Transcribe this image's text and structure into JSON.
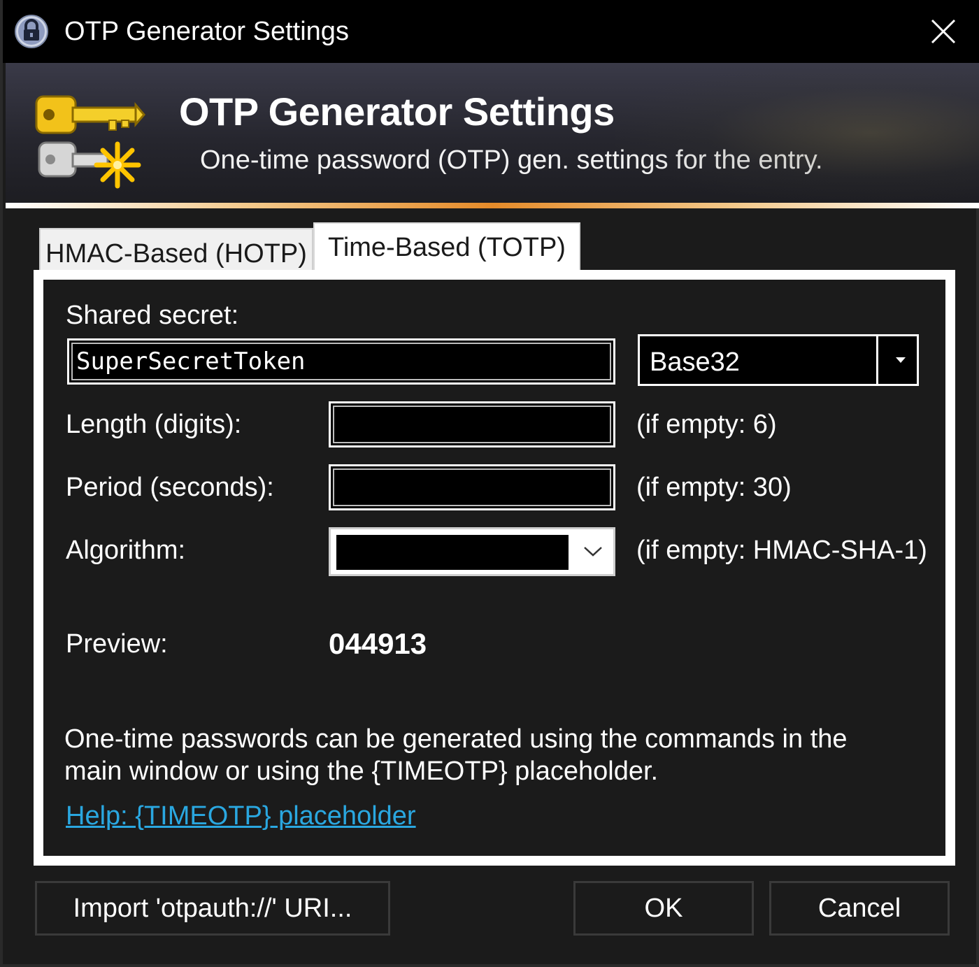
{
  "window": {
    "title": "OTP Generator Settings",
    "app_icon": "lock-icon",
    "close_icon": "close-icon"
  },
  "banner": {
    "title": "OTP Generator Settings",
    "subtitle": "One-time password (OTP) gen. settings for the entry.",
    "icon": "keys-icon"
  },
  "tabs": [
    {
      "label": "HMAC-Based (HOTP)",
      "selected": false
    },
    {
      "label": "Time-Based (TOTP)",
      "selected": true
    }
  ],
  "form": {
    "shared_secret_label": "Shared secret:",
    "shared_secret_value": "SuperSecretToken",
    "encoding_value": "Base32",
    "length_label": "Length (digits):",
    "length_value": "",
    "length_hint": "(if empty: 6)",
    "period_label": "Period (seconds):",
    "period_value": "",
    "period_hint": "(if empty: 30)",
    "algorithm_label": "Algorithm:",
    "algorithm_value": "",
    "algorithm_hint": "(if empty: HMAC-SHA-1)",
    "preview_label": "Preview:",
    "preview_value": "044913",
    "info_text": "One-time passwords can be generated using the commands in the main window or using the {TIMEOTP} placeholder.",
    "help_link": "Help: {TIMEOTP} placeholder"
  },
  "buttons": {
    "import_label": "Import 'otpauth://' URI...",
    "ok_label": "OK",
    "cancel_label": "Cancel"
  },
  "colors": {
    "background": "#1b1b1b",
    "title_bar": "#000000",
    "link": "#2aa7e0",
    "accent_line": "#e58b2a"
  }
}
